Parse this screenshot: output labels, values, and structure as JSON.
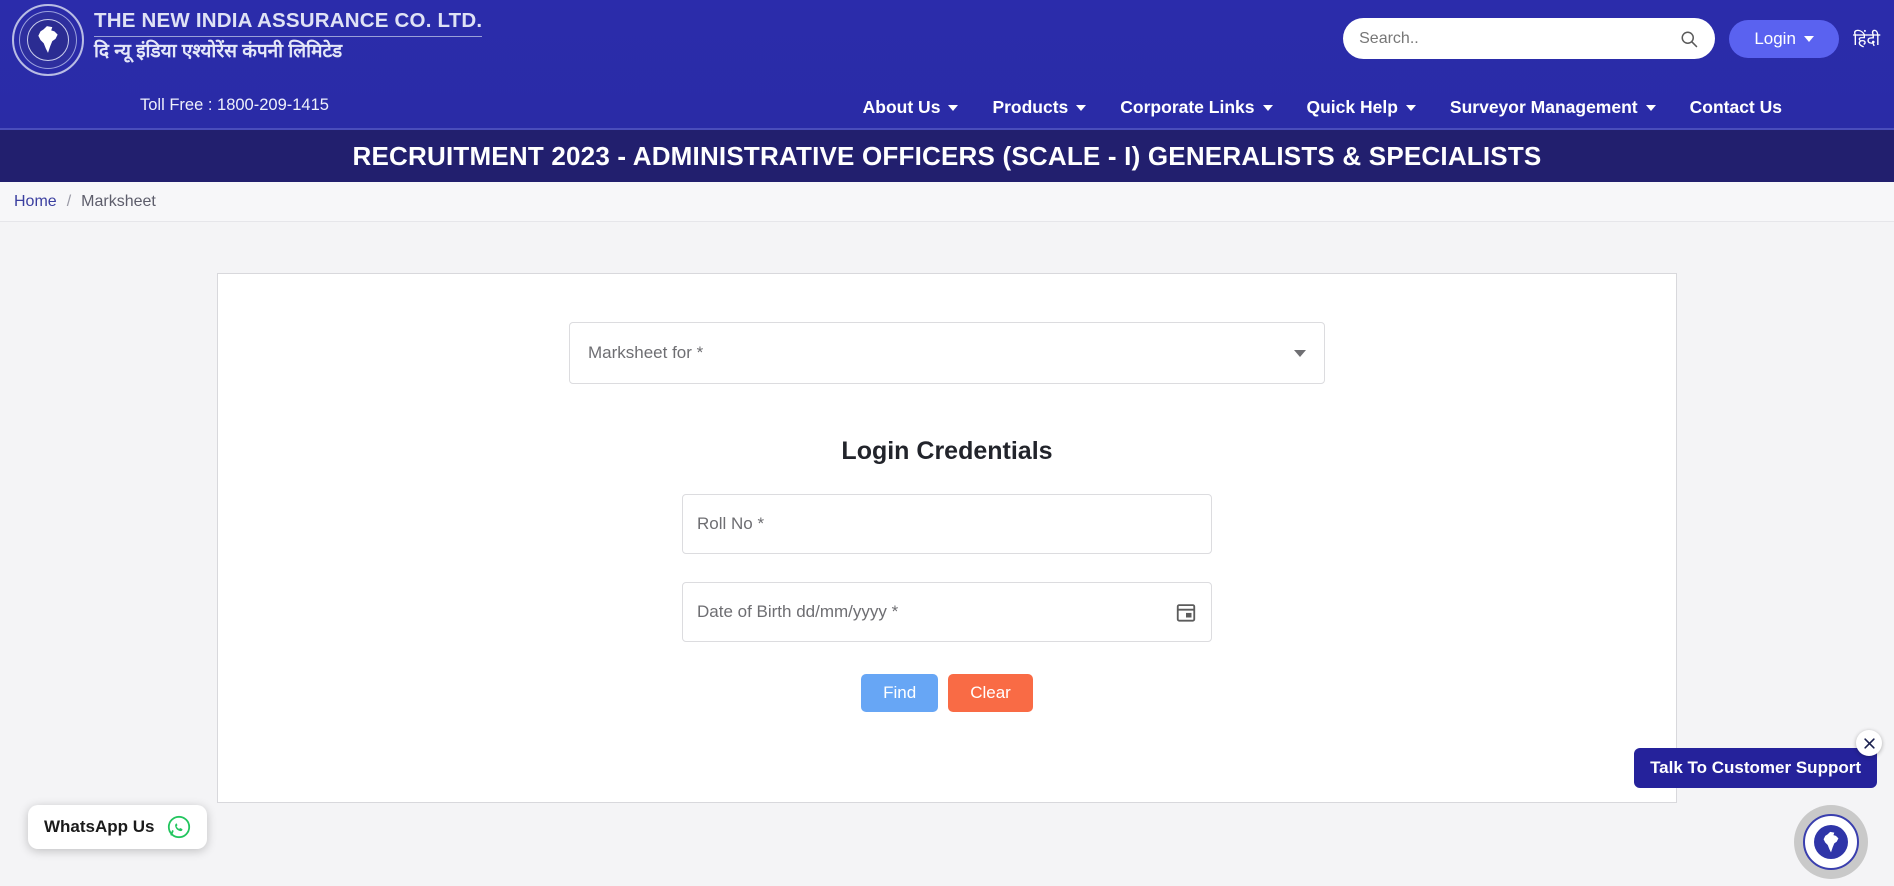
{
  "header": {
    "brand_en": "THE NEW INDIA ASSURANCE CO. LTD.",
    "brand_hi": "दि न्यू इंडिया एश्योरेंस कंपनी लिमिटेड",
    "toll_free": "Toll Free : 1800-209-1415",
    "search_placeholder": "Search..",
    "search_value": "",
    "login_label": "Login",
    "language_label": "हिंदी",
    "nav_items": [
      {
        "label": "About Us",
        "has_caret": true
      },
      {
        "label": "Products",
        "has_caret": true
      },
      {
        "label": "Corporate Links",
        "has_caret": true
      },
      {
        "label": "Quick Help",
        "has_caret": true
      },
      {
        "label": "Surveyor Management",
        "has_caret": true
      },
      {
        "label": "Contact Us",
        "has_caret": false
      }
    ],
    "colors": {
      "header_bg": "#2a2ba8",
      "banner_bg": "#221f6e",
      "login_btn": "#5a62f0"
    }
  },
  "banner": {
    "title": "RECRUITMENT 2023 - ADMINISTRATIVE OFFICERS (SCALE - I) GENERALISTS & SPECIALISTS"
  },
  "breadcrumb": {
    "home": "Home",
    "separator": "/",
    "current": "Marksheet"
  },
  "form": {
    "marksheet_select_placeholder": "Marksheet for *",
    "marksheet_select_value": "",
    "credentials_title": "Login Credentials",
    "roll_no_placeholder": "Roll No *",
    "roll_no_value": "",
    "dob_placeholder": "Date of Birth dd/mm/yyyy *",
    "dob_value": "",
    "find_label": "Find",
    "clear_label": "Clear",
    "colors": {
      "find_btn": "#67a6f5",
      "clear_btn": "#f96b45"
    }
  },
  "widgets": {
    "whatsapp_label": "WhatsApp Us",
    "support_label": "Talk To Customer Support"
  }
}
